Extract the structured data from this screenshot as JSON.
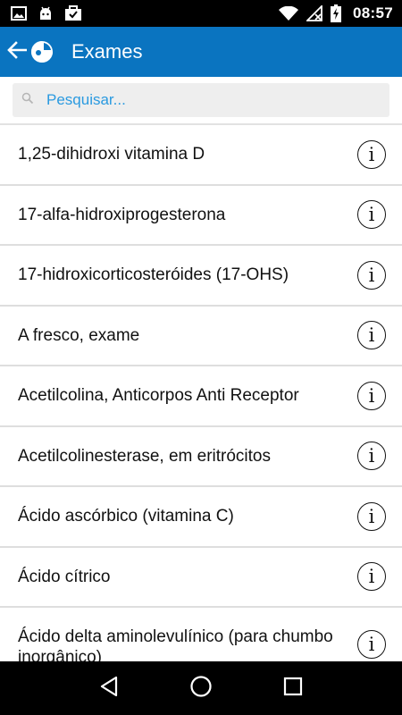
{
  "status_bar": {
    "time": "08:57",
    "icons": [
      "image-notification-icon",
      "android-notification-icon",
      "briefcase-check-notification-icon",
      "wifi-icon",
      "no-signal-icon",
      "battery-charging-icon"
    ]
  },
  "app_bar": {
    "title": "Exames",
    "color": "#0a74c0"
  },
  "search": {
    "placeholder": "Pesquisar...",
    "placeholder_color": "#2a9ae0"
  },
  "exams": [
    "1,25-dihidroxi vitamina D",
    "17-alfa-hidroxiprogesterona",
    "17-hidroxicorticosteróides (17-OHS)",
    "A fresco, exame",
    "Acetilcolina, Anticorpos Anti Receptor",
    "Acetilcolinesterase, em eritrócitos",
    "Ácido ascórbico (vitamina C)",
    "Ácido cítrico",
    "Ácido delta aminolevulínico (para chumbo inorgânico)"
  ],
  "info_glyph": "i",
  "nav": [
    "back-nav-icon",
    "home-nav-icon",
    "recents-nav-icon"
  ]
}
